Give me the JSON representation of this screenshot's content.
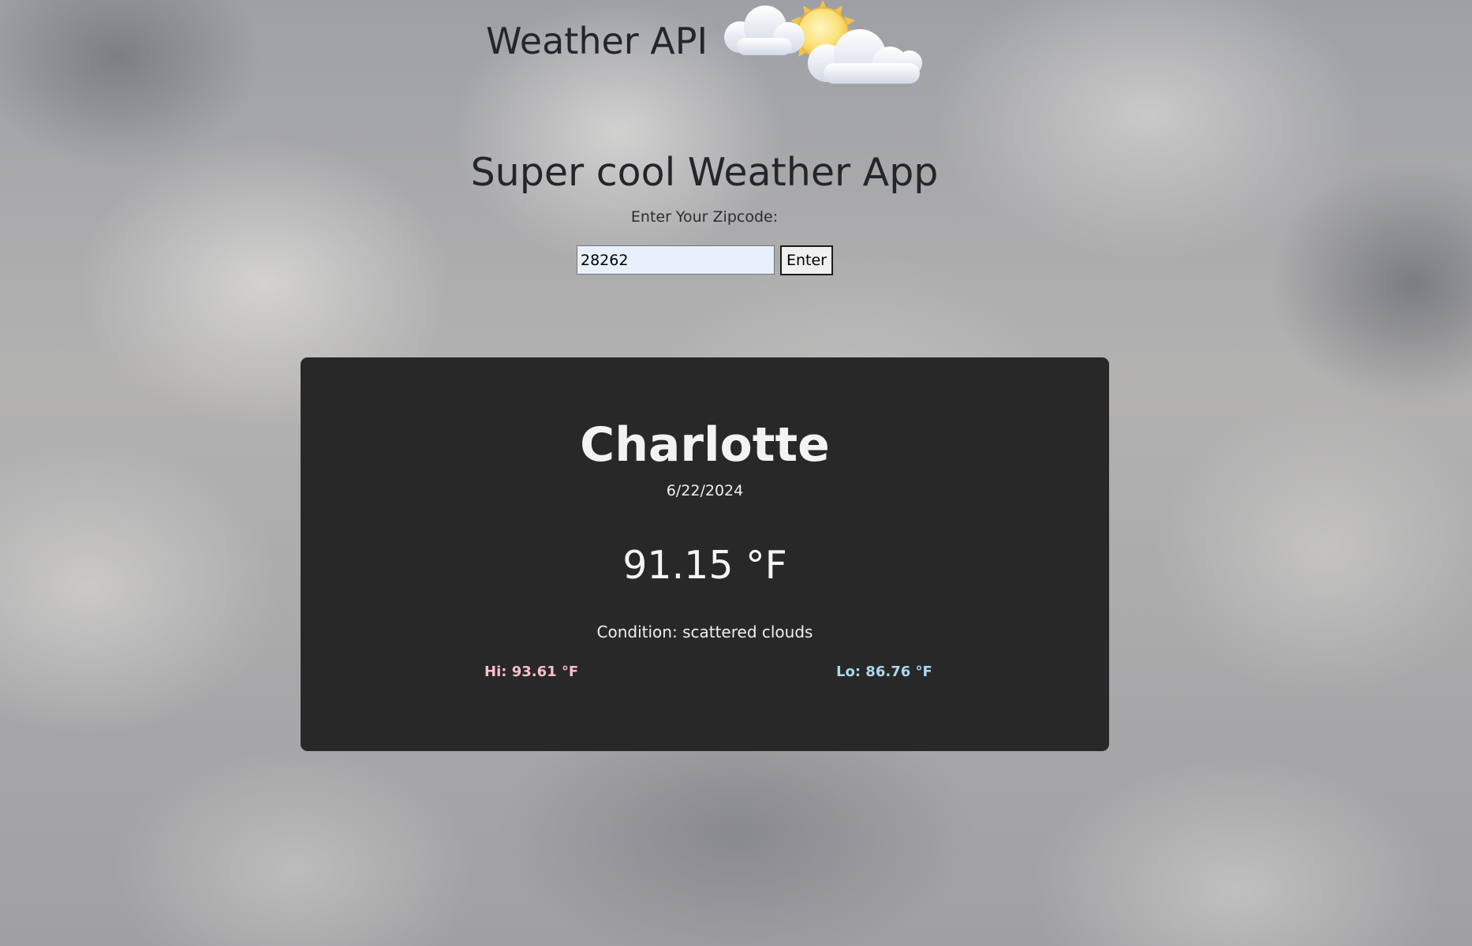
{
  "header": {
    "title": "Weather API",
    "logo_icon": "partly-cloudy-icon"
  },
  "main": {
    "subtitle": "Super cool Weather App",
    "zip_label": "Enter Your Zipcode:",
    "zip_value": "28262",
    "enter_label": "Enter"
  },
  "weather": {
    "city": "Charlotte",
    "date": "6/22/2024",
    "temperature": "91.15 °F",
    "condition": "Condition: scattered clouds",
    "hi": "Hi: 93.61 °F",
    "lo": "Lo: 86.76 °F"
  },
  "colors": {
    "card_background": "#282828",
    "hi_color": "#ffbfca",
    "lo_color": "#abd9ec"
  }
}
